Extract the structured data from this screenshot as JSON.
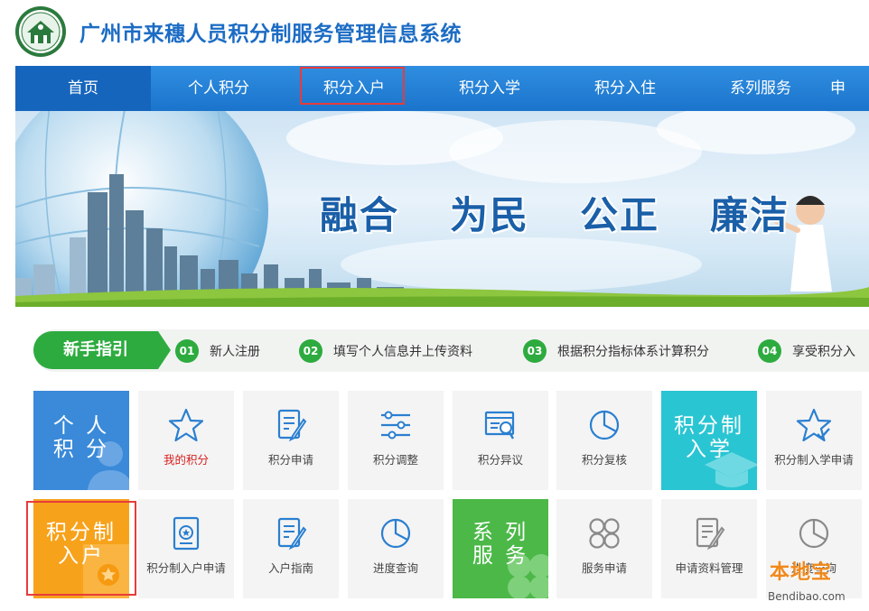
{
  "header": {
    "title": "广州市来穗人员积分制服务管理信息系统"
  },
  "nav": {
    "items": [
      {
        "label": "首页"
      },
      {
        "label": "个人积分"
      },
      {
        "label": "积分入户"
      },
      {
        "label": "积分入学"
      },
      {
        "label": "积分入住"
      },
      {
        "label": "系列服务"
      },
      {
        "label": "申"
      }
    ],
    "active_index": 0,
    "highlighted_index": 2
  },
  "banner": {
    "slogans": [
      "融合",
      "为民",
      "公正",
      "廉洁"
    ]
  },
  "guide": {
    "badge": "新手指引",
    "steps": [
      {
        "num": "01",
        "label": "新人注册"
      },
      {
        "num": "02",
        "label": "填写个人信息并上传资料"
      },
      {
        "num": "03",
        "label": "根据积分指标体系计算积分"
      },
      {
        "num": "04",
        "label": "享受积分入"
      }
    ]
  },
  "tiles": {
    "row1": {
      "category": "个 人\n积 分",
      "my_score": "我的积分",
      "apply": "积分申请",
      "adjust": "积分调整",
      "dispute": "积分异议",
      "review": "积分复核",
      "school_category": "积分制\n入学",
      "school_apply": "积分制入学申请"
    },
    "row2": {
      "category": "积分制\n入户",
      "hukou_apply": "积分制入户申请",
      "guide": "入户指南",
      "progress": "进度查询",
      "service_category": "系 列\n服 务",
      "service_apply": "服务申请",
      "material_manage": "申请资料管理",
      "appointment": "进度查询"
    }
  },
  "watermark": {
    "brand": "本地宝",
    "url": "Bendibao.com"
  },
  "colors": {
    "title_blue": "#1c6cc4",
    "nav_blue": "#1b74cc",
    "guide_green": "#2dab3f",
    "highlight_red": "#e83b3b",
    "tile_blue": "#3a8ad9",
    "tile_teal": "#2ac5d3",
    "tile_orange": "#f7a21b",
    "tile_green": "#4cb848"
  }
}
